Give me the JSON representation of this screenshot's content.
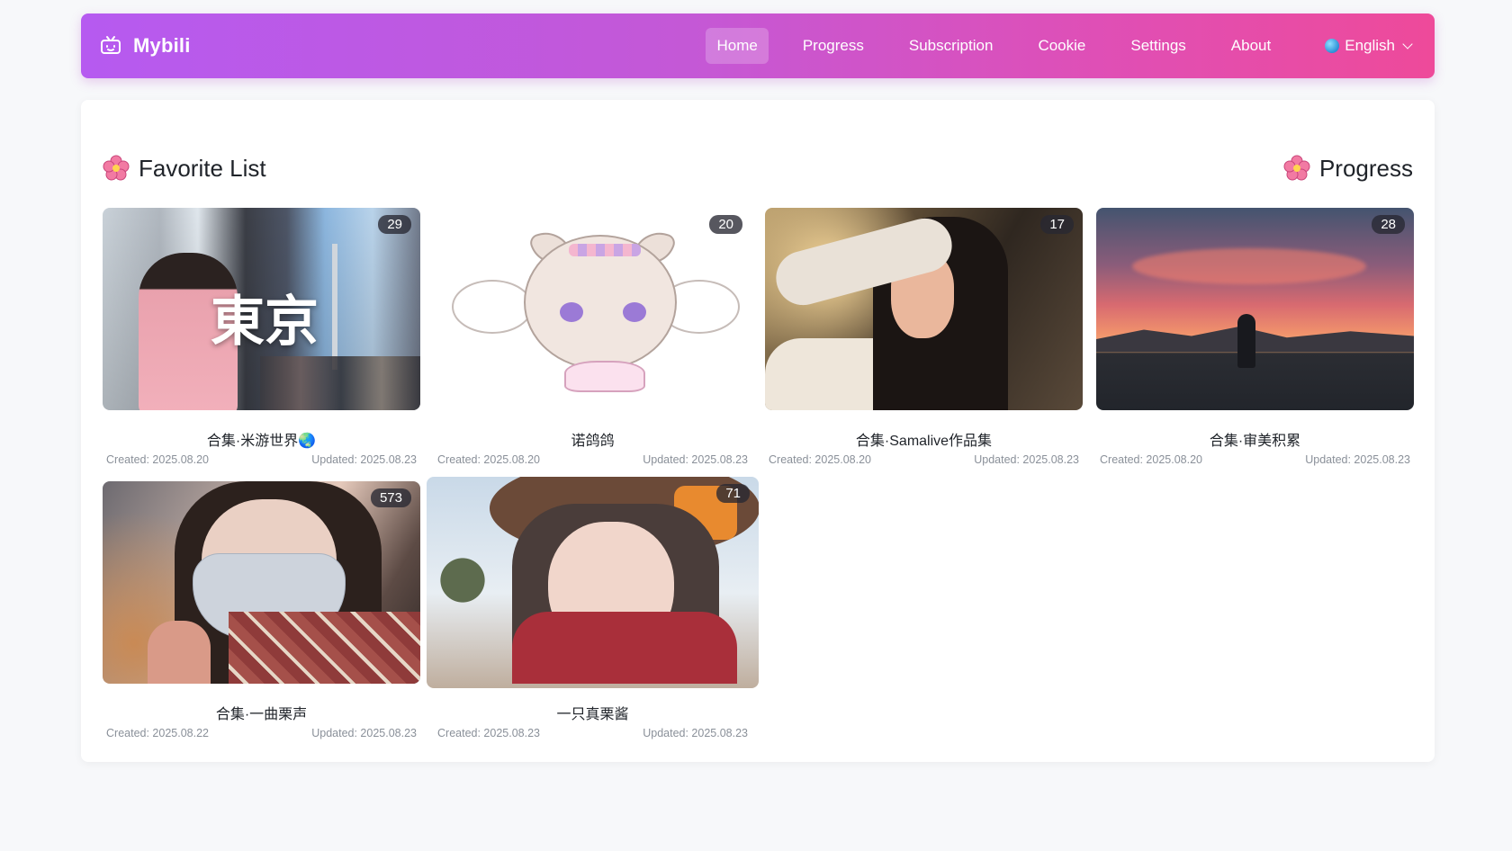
{
  "app": {
    "brand": "Mybili"
  },
  "nav": {
    "items": [
      {
        "label": "Home",
        "active": true
      },
      {
        "label": "Progress",
        "active": false
      },
      {
        "label": "Subscription",
        "active": false
      },
      {
        "label": "Cookie",
        "active": false
      },
      {
        "label": "Settings",
        "active": false
      },
      {
        "label": "About",
        "active": false
      }
    ],
    "language": "English"
  },
  "main": {
    "left_title": "Favorite List",
    "right_title": "Progress"
  },
  "favorites": [
    {
      "title": "合集·米游世界🌏",
      "count": "29",
      "created": "Created: 2025.08.20",
      "updated": "Updated: 2025.08.23"
    },
    {
      "title": "诺鸽鸽",
      "count": "20",
      "created": "Created: 2025.08.20",
      "updated": "Updated: 2025.08.23"
    },
    {
      "title": "合集·Samalive作品集",
      "count": "17",
      "created": "Created: 2025.08.20",
      "updated": "Updated: 2025.08.23"
    },
    {
      "title": "合集·审美积累",
      "count": "28",
      "created": "Created: 2025.08.20",
      "updated": "Updated: 2025.08.23"
    },
    {
      "title": "合集·一曲栗声",
      "count": "573",
      "created": "Created: 2025.08.22",
      "updated": "Updated: 2025.08.23"
    },
    {
      "title": "一只真栗酱",
      "count": "71",
      "created": "Created: 2025.08.23",
      "updated": "Updated: 2025.08.23"
    }
  ],
  "thumbnail_texts": {
    "tokyo_kanji": "東京"
  },
  "colors": {
    "nav_gradient_start": "#b65af0",
    "nav_gradient_end": "#ee4a9a",
    "page_bg": "#f7f8fa",
    "badge_bg": "#282832"
  },
  "icons": {
    "brand": "tv-icon",
    "section": "sakura-flower-icon",
    "language": "globe-icon",
    "dropdown": "chevron-down-icon"
  }
}
